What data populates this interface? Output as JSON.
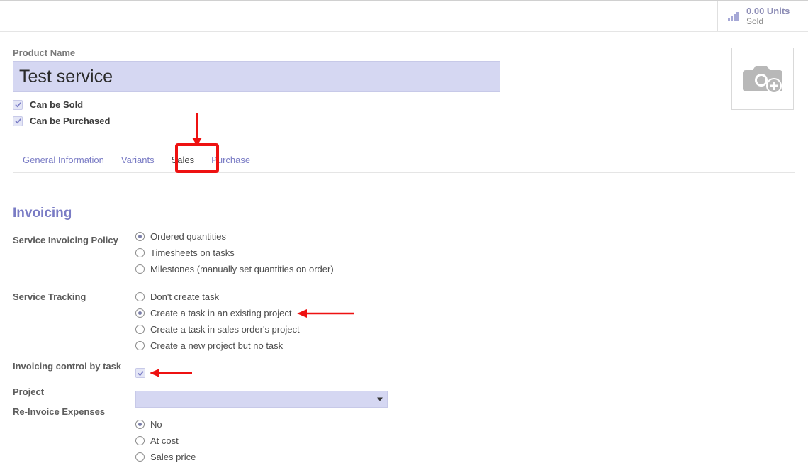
{
  "status": {
    "units": "0.00 Units",
    "sold": "Sold"
  },
  "product": {
    "name_label": "Product Name",
    "name_value": "Test service",
    "can_be_sold": "Can be Sold",
    "can_be_purchased": "Can be Purchased"
  },
  "tabs": {
    "general": "General Information",
    "variants": "Variants",
    "sales": "Sales",
    "purchase": "Purchase"
  },
  "section": {
    "invoicing": "Invoicing"
  },
  "fields": {
    "service_invoicing_policy": "Service Invoicing Policy",
    "service_tracking": "Service Tracking",
    "invoicing_control_by_task": "Invoicing control by task",
    "project": "Project",
    "re_invoice_expenses": "Re-Invoice Expenses"
  },
  "policy_options": {
    "o1": "Ordered quantities",
    "o2": "Timesheets on tasks",
    "o3": "Milestones (manually set quantities on order)"
  },
  "tracking_options": {
    "o1": "Don't create task",
    "o2": "Create a task in an existing project",
    "o3": "Create a task in sales order's project",
    "o4": "Create a new project but no task"
  },
  "project_value": "",
  "reinvoice_options": {
    "o1": "No",
    "o2": "At cost",
    "o3": "Sales price"
  }
}
